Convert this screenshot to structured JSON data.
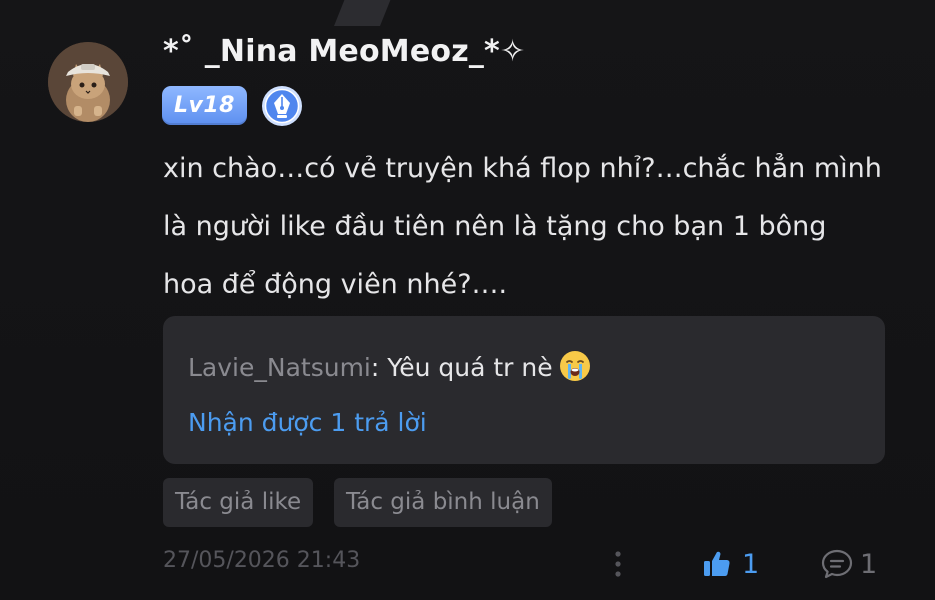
{
  "user": {
    "name": "*˚ _Nina MeoMeoz_*✧",
    "level": "Lv18"
  },
  "comment": {
    "text": "xin chào…có vẻ truyện khá flop nhỉ?…chắc hẳn mình là người like đầu tiên nên là tặng cho bạn 1 bông hoa để động viên nhé?…."
  },
  "reply_preview": {
    "author": "Lavie_Natsumi",
    "separator": ": ",
    "content": "Yêu quá tr nè",
    "replies_link": "Nhận được 1 trả lời"
  },
  "tags": {
    "author_like": "Tác giả like",
    "author_comment": "Tác giả bình luận"
  },
  "footer": {
    "timestamp": "27/05/2026 21:43",
    "like_count": "1",
    "comment_count": "1"
  },
  "colors": {
    "background": "#121214",
    "accent": "#4c9cf0",
    "level_badge": "#6f9df5",
    "card": "#2a2a2e",
    "muted_text": "#8a8a90"
  },
  "icons": {
    "avatar": "cat-avatar",
    "level": "level-badge",
    "writer": "pen-nib-icon",
    "emoji": "crying-face-icon",
    "more": "more-vertical-icon",
    "like": "thumbs-up-icon",
    "comment": "comment-bubble-icon"
  }
}
